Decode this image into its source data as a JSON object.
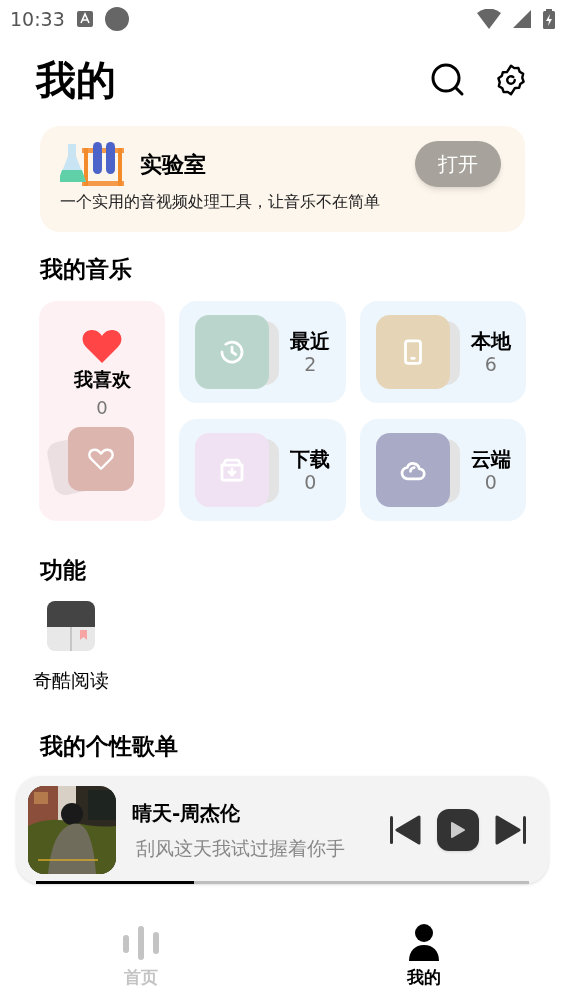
{
  "status_bar": {
    "time": "10:33"
  },
  "header": {
    "title": "我的"
  },
  "lab": {
    "title": "实验室",
    "description": "一个实用的音视频处理工具，让音乐不在简单",
    "button": "打开"
  },
  "my_music": {
    "heading": "我的音乐",
    "favorite": {
      "label": "我喜欢",
      "count": "0"
    },
    "items": [
      {
        "kind": "recent",
        "label": "最近",
        "count": "2",
        "color": "#b9d5cc"
      },
      {
        "kind": "local",
        "label": "本地",
        "count": "6",
        "color": "#e5d4b6"
      },
      {
        "kind": "download",
        "label": "下载",
        "count": "0",
        "color": "#f0e2f3"
      },
      {
        "kind": "cloud",
        "label": "云端",
        "count": "0",
        "color": "#a9aac6"
      }
    ]
  },
  "features": {
    "heading": "功能",
    "items": [
      {
        "label": "奇酷阅读"
      }
    ]
  },
  "playlists": {
    "heading": "我的个性歌单"
  },
  "player": {
    "title": "晴天-周杰伦",
    "lyric": "刮风这天我试过握着你手",
    "level": 0.32
  },
  "nav": [
    {
      "kind": "home",
      "label": "首页",
      "selected": false
    },
    {
      "kind": "mine",
      "label": "我的",
      "selected": true
    }
  ]
}
